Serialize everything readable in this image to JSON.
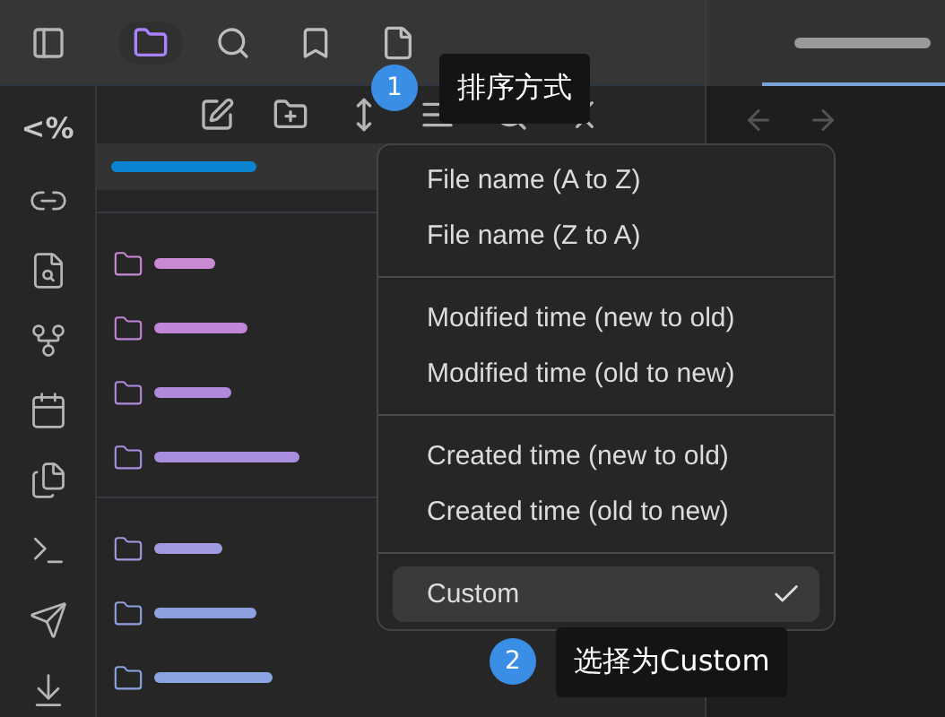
{
  "tabs": [
    {
      "selected": true
    },
    {
      "selected": false
    },
    {
      "selected": false
    },
    {
      "selected": false
    }
  ],
  "ribbon": {
    "template_label": "<%"
  },
  "folder_groups": [
    [
      {
        "color": "#c88ad2"
      },
      {
        "color": "#c084d8"
      },
      {
        "color": "#b088dc"
      },
      {
        "color": "#a98ee0"
      }
    ],
    [
      {
        "color": "#a09ae0"
      },
      {
        "color": "#8fa0e0"
      },
      {
        "color": "#8aa4e2"
      }
    ]
  ],
  "sort_menu": {
    "groups": [
      [
        {
          "label": "File name (A to Z)",
          "selected": false
        },
        {
          "label": "File name (Z to A)",
          "selected": false
        }
      ],
      [
        {
          "label": "Modified time (new to old)",
          "selected": false
        },
        {
          "label": "Modified time (old to new)",
          "selected": false
        }
      ],
      [
        {
          "label": "Created time (new to old)",
          "selected": false
        },
        {
          "label": "Created time (old to new)",
          "selected": false
        }
      ],
      [
        {
          "label": "Custom",
          "selected": true
        }
      ]
    ]
  },
  "callouts": [
    {
      "number": "1",
      "text": "排序方式"
    },
    {
      "number": "2",
      "text": "选择为Custom"
    }
  ]
}
